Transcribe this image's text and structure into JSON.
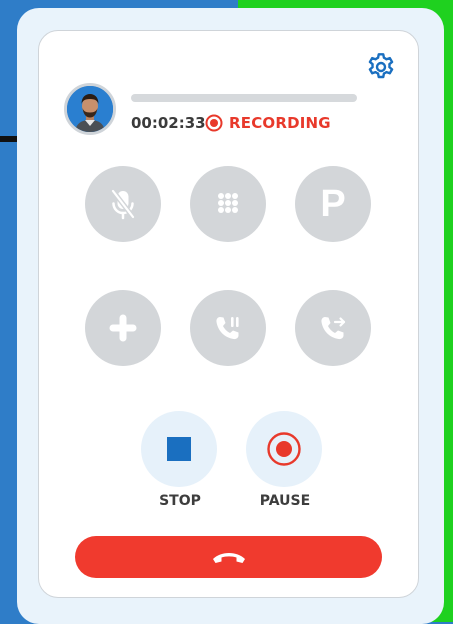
{
  "call": {
    "timer": "00:02:33",
    "recording_label": "RECORDING"
  },
  "controls": [
    {
      "name": "mute",
      "icon": "mic-off-icon"
    },
    {
      "name": "dialpad",
      "icon": "dialpad-icon"
    },
    {
      "name": "park",
      "icon": "park-icon",
      "glyph": "P"
    },
    {
      "name": "add-call",
      "icon": "plus-icon"
    },
    {
      "name": "hold",
      "icon": "phone-hold-icon"
    },
    {
      "name": "transfer",
      "icon": "phone-transfer-icon"
    }
  ],
  "recording": {
    "stop_label": "STOP",
    "pause_label": "PAUSE"
  },
  "colors": {
    "accent_blue": "#1a6fc0",
    "recording_red": "#e8392b",
    "hangup_red": "#f03a2e",
    "disabled_gray": "#d3d6d9"
  }
}
